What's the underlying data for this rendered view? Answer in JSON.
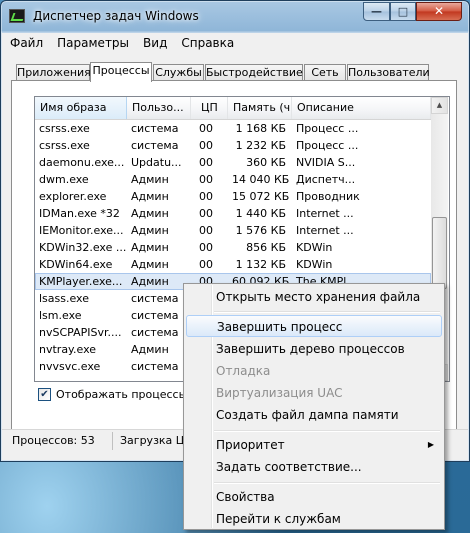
{
  "window": {
    "title": "Диспетчер задач Windows"
  },
  "titlebar_buttons": {
    "minimize": "—",
    "maximize": "□",
    "close": "✕"
  },
  "menu": [
    "Файл",
    "Параметры",
    "Вид",
    "Справка"
  ],
  "tabs": [
    "Приложения",
    "Процессы",
    "Службы",
    "Быстродействие",
    "Сеть",
    "Пользователи"
  ],
  "active_tab": "Процессы",
  "columns": [
    "Имя образа",
    "Пользо...",
    "ЦП",
    "Память (ч...",
    "Описание"
  ],
  "processes": [
    [
      "csrss.exe",
      "система",
      "00",
      "1 168 КБ",
      "Процесс ..."
    ],
    [
      "csrss.exe",
      "система",
      "00",
      "1 232 КБ",
      "Процесс ..."
    ],
    [
      "daemonu.exe...",
      "Updatu...",
      "00",
      "360 КБ",
      "NVIDIA S..."
    ],
    [
      "dwm.exe",
      "Админ",
      "00",
      "14 040 КБ",
      "Диспетч..."
    ],
    [
      "explorer.exe",
      "Админ",
      "00",
      "15 072 КБ",
      "Проводник"
    ],
    [
      "IDMan.exe *32",
      "Админ",
      "00",
      "1 440 КБ",
      "Internet ..."
    ],
    [
      "IEMonitor.exe...",
      "Админ",
      "00",
      "1 576 КБ",
      "Internet ..."
    ],
    [
      "KDWin32.exe ...",
      "Админ",
      "00",
      "856 КБ",
      "KDWin"
    ],
    [
      "KDWin64.exe",
      "Админ",
      "00",
      "1 132 КБ",
      "KDWin"
    ],
    [
      "KMPlayer.exe...",
      "Админ",
      "00",
      "60 092 КБ",
      "The KMPl..."
    ],
    [
      "lsass.exe",
      "система",
      "",
      "",
      ""
    ],
    [
      "lsm.exe",
      "система",
      "",
      "",
      ""
    ],
    [
      "nvSCPAPISvr....",
      "система",
      "",
      "",
      ""
    ],
    [
      "nvtray.exe",
      "Админ",
      "",
      "",
      ""
    ],
    [
      "nvvsvc.exe",
      "система",
      "",
      "",
      ""
    ]
  ],
  "show_all_processes": {
    "label": "Отображать процессы вс",
    "checked": "✔"
  },
  "status": {
    "processes": "Процессов: 53",
    "cpu": "Загрузка Ц"
  },
  "context_menu": {
    "items": [
      "Открыть место хранения файла",
      "Завершить процесс",
      "Завершить дерево процессов",
      "Отладка",
      "Виртуализация UAC",
      "Создать файл дампа памяти",
      "Приоритет",
      "Задать соответствие...",
      "Свойства",
      "Перейти к службам"
    ],
    "submenu_arrow": "▶"
  },
  "scrollbar": {
    "up": "▲",
    "down": "▼"
  }
}
